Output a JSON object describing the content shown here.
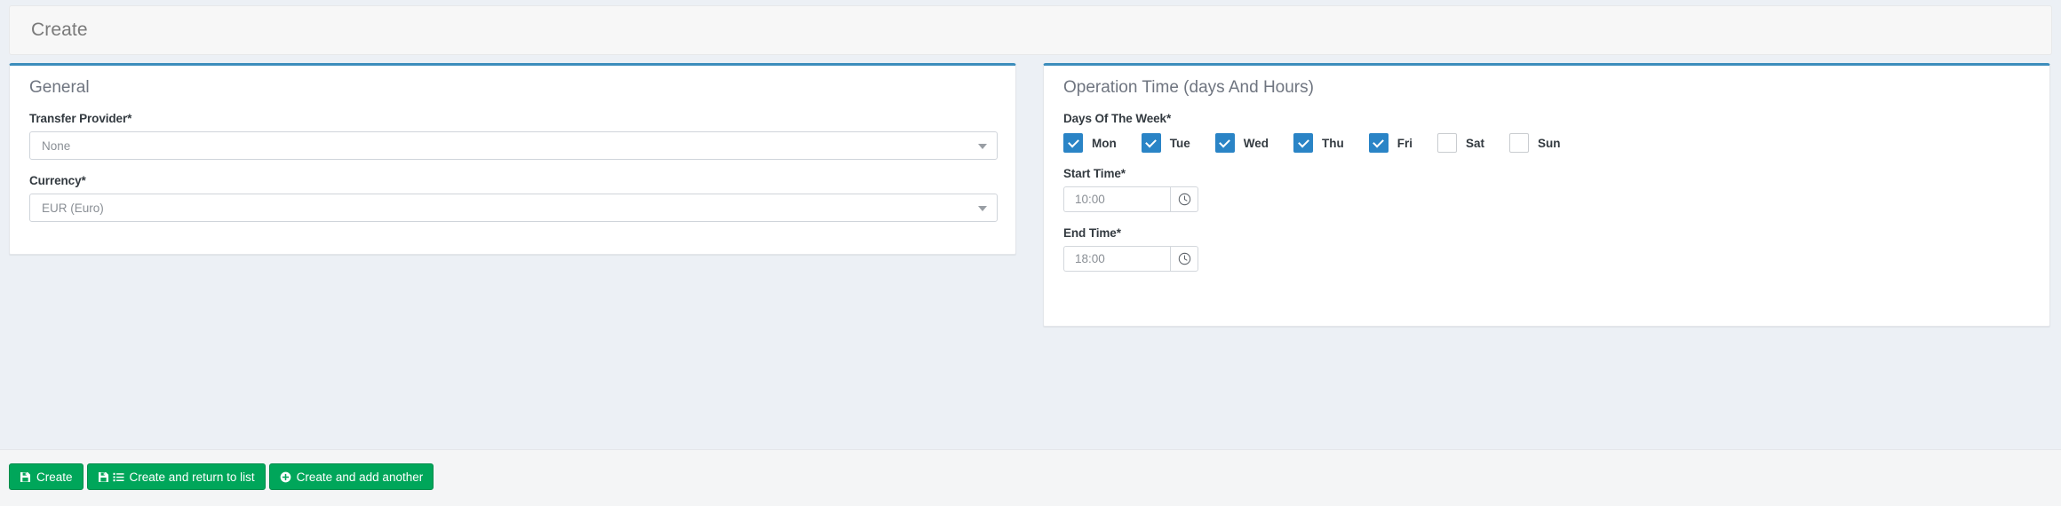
{
  "header": {
    "title": "Create"
  },
  "panels": {
    "general": {
      "title": "General",
      "fields": [
        {
          "label": "Transfer Provider*",
          "value": "None",
          "control": "select",
          "name": "transfer-provider"
        },
        {
          "label": "Currency*",
          "value": "EUR (Euro)",
          "control": "select",
          "name": "currency"
        }
      ]
    },
    "operation_time": {
      "title": "Operation Time (days And Hours)",
      "days_label": "Days Of The Week*",
      "days": [
        {
          "label": "Mon",
          "checked": true
        },
        {
          "label": "Tue",
          "checked": true
        },
        {
          "label": "Wed",
          "checked": true
        },
        {
          "label": "Thu",
          "checked": true
        },
        {
          "label": "Fri",
          "checked": true
        },
        {
          "label": "Sat",
          "checked": false
        },
        {
          "label": "Sun",
          "checked": false
        }
      ],
      "start_time": {
        "label": "Start Time*",
        "value": "10:00",
        "addon_icon": "clock-icon"
      },
      "end_time": {
        "label": "End Time*",
        "value": "18:00",
        "addon_icon": "clock-icon"
      }
    }
  },
  "footer": {
    "buttons": [
      {
        "label": "Create",
        "icons": [
          "save-icon"
        ],
        "name": "create-button"
      },
      {
        "label": "Create and return to list",
        "icons": [
          "save-icon",
          "list-icon"
        ],
        "name": "create-and-return-button"
      },
      {
        "label": "Create and add another",
        "icons": [
          "plus-circle-icon"
        ],
        "name": "create-and-add-another-button"
      }
    ]
  },
  "colors": {
    "panel_accent": "#3c8dbc",
    "checkbox_checked": "#2a84c6",
    "button_green": "#00a65a",
    "page_background": "#ecf0f5"
  }
}
